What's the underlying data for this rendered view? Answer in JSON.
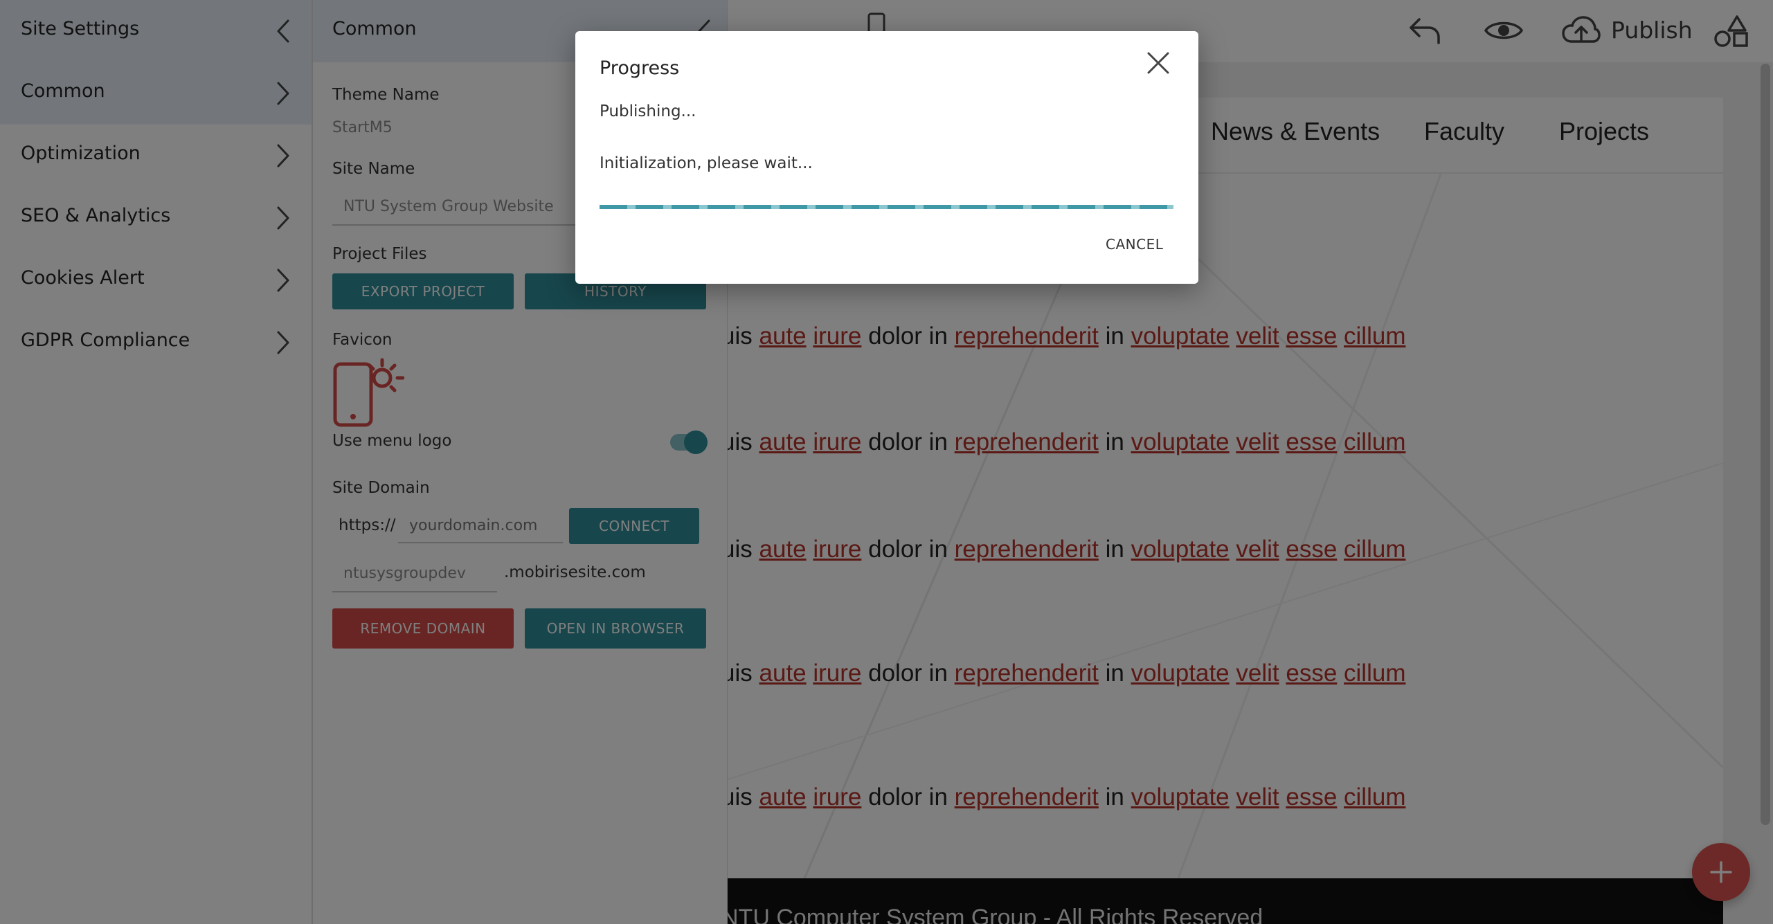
{
  "sidebar": {
    "title": "Site Settings",
    "items": [
      {
        "label": "Common"
      },
      {
        "label": "Optimization"
      },
      {
        "label": "SEO & Analytics"
      },
      {
        "label": "Cookies Alert"
      },
      {
        "label": "GDPR Compliance"
      }
    ]
  },
  "panel": {
    "title": "Common",
    "theme_name_label": "Theme Name",
    "theme_name_value": "StartM5",
    "site_name_label": "Site Name",
    "site_name_value": "NTU System Group Website",
    "project_files_label": "Project Files",
    "export_button": "EXPORT PROJECT",
    "history_button": "HISTORY",
    "favicon_label": "Favicon",
    "use_menu_logo_label": "Use menu logo",
    "use_menu_logo_on": true,
    "site_domain_label": "Site Domain",
    "domain_prefix": "https://",
    "domain_placeholder": "yourdomain.com",
    "connect_button": "CONNECT",
    "subdomain_value": "ntusysgroupdev",
    "subdomain_suffix": ".mobirisesite.com",
    "remove_domain_button": "REMOVE DOMAIN",
    "open_browser_button": "OPEN IN BROWSER"
  },
  "toolbar": {
    "publish_label": "Publish",
    "icons": [
      "mobile-preview-icon",
      "undo-icon",
      "preview-eye-icon",
      "cloud-upload-icon",
      "blocks-icon"
    ]
  },
  "site_preview": {
    "nav_links": [
      "News & Events",
      "Faculty",
      "Projects"
    ],
    "paragraph_lines": [
      "uis aute irure dolor in reprehenderit in voluptate velit esse cillum",
      "uis aute irure dolor in reprehenderit in voluptate velit esse cillum",
      "uis aute irure dolor in reprehenderit in voluptate velit esse cillum",
      "uis aute irure dolor in reprehenderit in voluptate velit esse cillum",
      "uis aute irure dolor in reprehenderit in voluptate velit esse cillum"
    ],
    "footer_text": "NTU Computer System Group - All Rights Reserved"
  },
  "dialog": {
    "title": "Progress",
    "status": "Publishing...",
    "message": "Initialization, please wait...",
    "cancel_button": "CANCEL"
  },
  "colors": {
    "accent": "#2f8d98",
    "danger": "#d24a47",
    "link": "#b5332a",
    "fab": "#d9534f"
  }
}
